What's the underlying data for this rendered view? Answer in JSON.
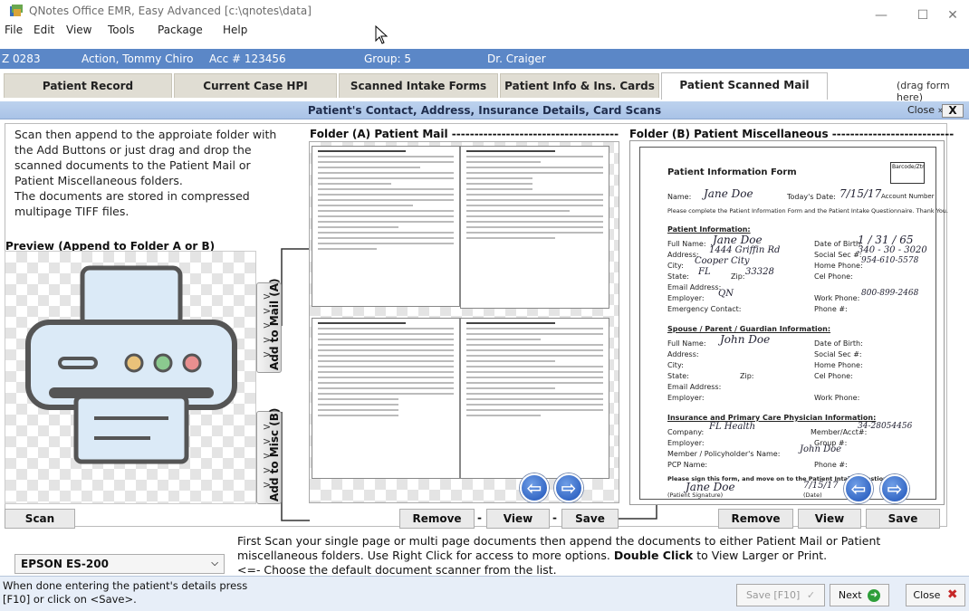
{
  "window": {
    "title": "QNotes Office EMR, Easy Advanced [c:\\qnotes\\data]",
    "controls": {
      "minimize": "—",
      "maximize": "☐",
      "close": "✕"
    }
  },
  "menu": [
    "File",
    "Edit",
    "View",
    "Tools",
    "Package",
    "Help"
  ],
  "patient_bar": {
    "id": "Z 0283",
    "name": "Action, Tommy Chiro",
    "account": "Acc # 123456",
    "group": "Group: 5",
    "doctor": "Dr. Craiger"
  },
  "tabs": [
    {
      "label": "Patient Record"
    },
    {
      "label": "Current Case HPI"
    },
    {
      "label": "Scanned Intake Forms"
    },
    {
      "label": "Patient Info & Ins. Cards"
    },
    {
      "label": "Patient Scanned Mail"
    }
  ],
  "drag_hint": "(drag form here)",
  "subheader": {
    "title": "Patient's Contact, Address, Insurance Details, Card Scans",
    "close_label": "Close »",
    "close_x": "X"
  },
  "instructions": "Scan then append to the approiate folder with the Add Buttons or just drag and drop the scanned documents to the Patient Mail or Patient Miscellaneous folders.\nThe documents are stored in compressed multipage TIFF files.",
  "preview_label": "Preview (Append to Folder A or B)",
  "side_buttons": {
    "mail": "Add to Mail (A)",
    "misc": "Add to Misc (B)",
    "arrow": ">"
  },
  "folder_a": {
    "title": "Folder (A) Patient Mail -------------------------------------"
  },
  "folder_b": {
    "title": "Folder (B) Patient Miscellaneous ---------------------------"
  },
  "form_preview": {
    "heading": "Patient Information Form",
    "barcode": "Barcode/Ztr",
    "name_label": "Name:",
    "name_value": "Jane Doe",
    "date_label": "Today's Date:",
    "date_value": "7/15/17",
    "account_label": "Account Number",
    "intro": "Please complete the Patient Information Form and the Patient Intake Questionnaire. Thank You.",
    "section1": "Patient Information:",
    "full_name_label": "Full Name:",
    "full_name_value": "Jane Doe",
    "dob_label": "Date of Birth:",
    "dob_value": "1 / 31 / 65",
    "address_label": "Address:",
    "address_value": "1444 Griffin Rd",
    "ssn_label": "Social Sec #:",
    "ssn_value": "340 - 30 - 3020",
    "city_label": "City:",
    "city_value": "Cooper City",
    "home_phone_label": "Home Phone:",
    "home_phone_value": "954-610-5578",
    "state_label": "State:",
    "state_value": "FL",
    "zip_label": "Zip:",
    "zip_value": "33328",
    "cell_label": "Cel Phone:",
    "email_label": "Email Address:",
    "employer_label": "Employer:",
    "employer_value": "QN",
    "work_phone_label": "Work Phone:",
    "work_phone_value": "800-899-2468",
    "emergency_label": "Emergency Contact:",
    "phone_label": "Phone #:",
    "section2": "Spouse / Parent / Guardian Information:",
    "spouse_value": "John Doe",
    "section3": "Insurance and Primary Care Physician Information:",
    "company_label": "Company:",
    "company_value": "FL Health",
    "member_label": "Member/Acct#:",
    "member_value": "34-28054456",
    "group_label": "Group #:",
    "policyholder_label": "Member / Policyholder's Name:",
    "policyholder_value": "John Doe",
    "pcp_label": "PCP Name:",
    "sign_text": "Please sign this form, and move on to the Patient Intake Questionnaire.",
    "signature_value": "Jane Doe",
    "sig_date_value": "7/15/17",
    "sig_label": "(Patient Signature)",
    "sig_date_label": "(Date)"
  },
  "buttons": {
    "scan": "Scan",
    "remove": "Remove",
    "view": "View",
    "save": "Save",
    "dash": "-"
  },
  "scanner": "EPSON ES-200",
  "bottom_note": {
    "part1": "First Scan your single page or multi page documents then append the documents to either Patient Mail or Patient miscellaneous folders.   Use Right Click for access to more options.",
    "bold": "Double Click",
    "part2": "to View Larger or Print.",
    "line3": "<=- Choose the default document scanner from the list."
  },
  "status": {
    "text": "When done entering the patient's details press\n[F10] or click on <Save>.",
    "save": "Save [F10]",
    "next": "Next",
    "close": "Close"
  }
}
